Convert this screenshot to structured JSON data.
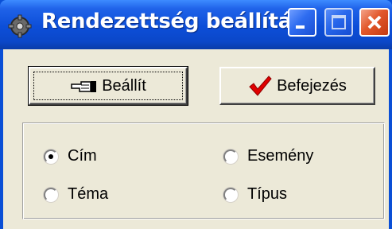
{
  "window": {
    "title": "Rendezettség beállítá...",
    "icon": "gear-icon",
    "controls": [
      "minimize-icon",
      "maximize-icon",
      "close-icon"
    ]
  },
  "buttons": {
    "set_label": "Beállít",
    "set_icon": "pointing-hand-icon",
    "done_label": "Befejezés",
    "done_icon": "checkmark-icon"
  },
  "sort_options": [
    {
      "label": "Cím",
      "checked": true
    },
    {
      "label": "Esemény",
      "checked": false
    },
    {
      "label": "Téma",
      "checked": false
    },
    {
      "label": "Típus",
      "checked": false
    }
  ],
  "colors": {
    "title_bar": "#0a4fd6",
    "close_button": "#e2582b",
    "dialog_background": "#ece9d8",
    "checkmark": "#e00000"
  }
}
